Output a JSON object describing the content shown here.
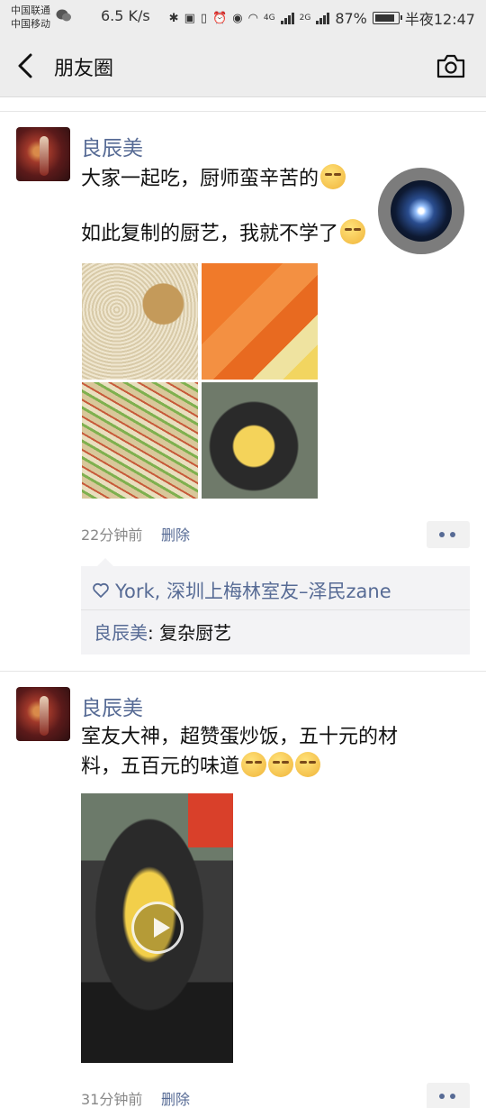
{
  "status_bar": {
    "carrier1": "中国联通",
    "carrier2": "中国移动",
    "speed": "6.5 K/s",
    "network1": "4G",
    "network2": "2G",
    "battery": "87%",
    "time": "半夜12:47"
  },
  "nav": {
    "title": "朋友圈"
  },
  "posts": [
    {
      "author": "良辰美",
      "line1": "大家一起吃，厨师蛮辛苦的",
      "line2": "如此复制的厨艺，我就不学了",
      "time": "22分钟前",
      "delete_label": "删除",
      "likes": "York, 深圳上梅林室友–泽民zane",
      "comment_author": "良辰美",
      "comment_sep": ": ",
      "comment_text": "复杂厨艺"
    },
    {
      "author": "良辰美",
      "line1": "室友大神，超赞蛋炒饭，五十元的材",
      "line2": "料，五百元的味道",
      "time": "31分钟前",
      "delete_label": "删除"
    }
  ],
  "colors": {
    "link": "#576b95",
    "bar_bg": "#ededed"
  }
}
